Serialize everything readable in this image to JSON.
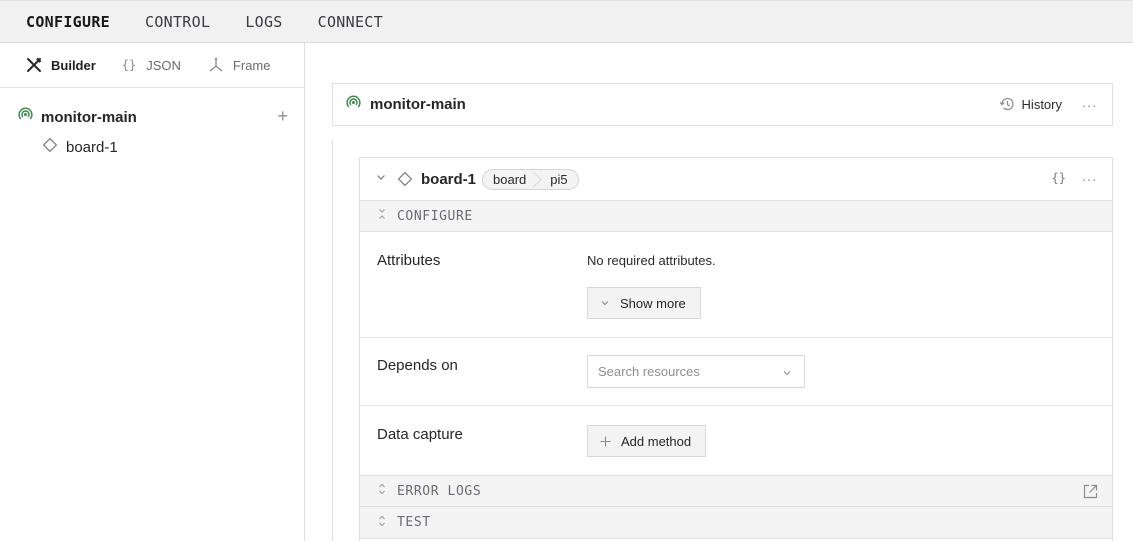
{
  "topbar": {
    "tabs": [
      {
        "label": "CONFIGURE",
        "active": true
      },
      {
        "label": "CONTROL",
        "active": false
      },
      {
        "label": "LOGS",
        "active": false
      },
      {
        "label": "CONNECT",
        "active": false
      }
    ]
  },
  "sidebar": {
    "modes": [
      {
        "label": "Builder",
        "icon": "tools-icon",
        "active": true
      },
      {
        "label": "JSON",
        "icon": "braces-icon",
        "icon_glyph": "{}",
        "active": false
      },
      {
        "label": "Frame",
        "icon": "frame-axes-icon",
        "active": false
      }
    ],
    "tree": {
      "root": {
        "label": "monitor-main",
        "icon": "machine-signal-icon",
        "add_glyph": "+"
      },
      "children": [
        {
          "label": "board-1",
          "icon": "diamond-icon"
        }
      ]
    }
  },
  "main": {
    "machine": {
      "name": "monitor-main",
      "history_label": "History",
      "menu_glyph": "···"
    },
    "resource": {
      "name": "board-1",
      "api": "board",
      "model": "pi5",
      "json_glyph": "{}",
      "menu_glyph": "···",
      "sections": {
        "configure": "CONFIGURE",
        "error_logs": "ERROR LOGS",
        "test": "TEST"
      },
      "attributes": {
        "label": "Attributes",
        "note": "No required attributes.",
        "show_more": "Show more"
      },
      "depends_on": {
        "label": "Depends on",
        "placeholder": "Search resources"
      },
      "data_capture": {
        "label": "Data capture",
        "add_method": "Add method"
      }
    }
  },
  "colors": {
    "accent_green": "#3d8b4a",
    "topbar_bg": "#f1f1f2",
    "section_bg": "#f4f4f5"
  }
}
